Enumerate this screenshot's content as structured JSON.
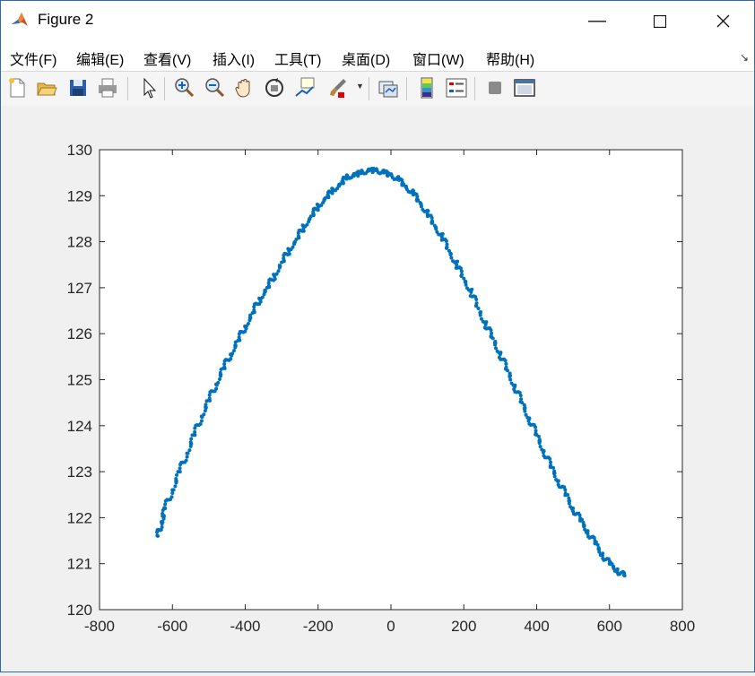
{
  "window": {
    "title": "Figure 2"
  },
  "menu": {
    "items": [
      "文件(F)",
      "编辑(E)",
      "查看(V)",
      "插入(I)",
      "工具(T)",
      "桌面(D)",
      "窗口(W)",
      "帮助(H)"
    ]
  },
  "toolbar": {
    "icons": [
      "new-figure-icon",
      "open-icon",
      "save-icon",
      "print-icon",
      "pointer-icon",
      "zoom-in-icon",
      "zoom-out-icon",
      "pan-icon",
      "rotate-3d-icon",
      "data-cursor-icon",
      "brush-icon",
      "link-plot-icon",
      "colorbar-icon",
      "legend-icon",
      "hide-plot-tools-icon",
      "show-plot-tools-icon"
    ]
  },
  "colors": {
    "marker": "#0072BD",
    "axes": "#262626",
    "background": "#f0f0f0"
  },
  "chart_data": {
    "type": "scatter",
    "title": "",
    "xlabel": "",
    "ylabel": "",
    "xlim": [
      -800,
      800
    ],
    "ylim": [
      120,
      130
    ],
    "xticks": [
      "-800",
      "-600",
      "-400",
      "-200",
      "0",
      "200",
      "400",
      "600",
      "800"
    ],
    "yticks": [
      "120",
      "121",
      "122",
      "123",
      "124",
      "125",
      "126",
      "127",
      "128",
      "129",
      "130"
    ],
    "grid": false,
    "marker_color": "#0072BD",
    "series": [
      {
        "x": [
          -640,
          -630,
          -620,
          -600,
          -580,
          -560,
          -540,
          -520,
          -500,
          -480,
          -460,
          -440,
          -420,
          -400,
          -380,
          -360,
          -340,
          -320,
          -300,
          -280,
          -260,
          -240,
          -220,
          -200,
          -180,
          -160,
          -140,
          -120,
          -100,
          -80,
          -60,
          -40,
          -20,
          0,
          20,
          40,
          60,
          80,
          100,
          120,
          140,
          160,
          180,
          200,
          220,
          240,
          260,
          280,
          300,
          320,
          340,
          360,
          380,
          400,
          420,
          440,
          460,
          480,
          500,
          520,
          540,
          560,
          580,
          600,
          620,
          640
        ],
        "y": [
          121.6,
          121.9,
          122.2,
          122.6,
          123.0,
          123.4,
          123.8,
          124.2,
          124.55,
          124.9,
          125.25,
          125.55,
          125.85,
          126.15,
          126.45,
          126.75,
          127.0,
          127.25,
          127.55,
          127.8,
          128.05,
          128.3,
          128.55,
          128.75,
          128.95,
          129.1,
          129.25,
          129.4,
          129.45,
          129.5,
          129.55,
          129.55,
          129.5,
          129.45,
          129.35,
          129.2,
          129.05,
          128.85,
          128.6,
          128.35,
          128.1,
          127.8,
          127.5,
          127.2,
          126.9,
          126.55,
          126.2,
          125.9,
          125.55,
          125.2,
          124.85,
          124.5,
          124.15,
          123.8,
          123.45,
          123.1,
          122.8,
          122.5,
          122.2,
          121.95,
          121.7,
          121.45,
          121.2,
          121.0,
          120.85,
          120.75
        ]
      }
    ]
  }
}
